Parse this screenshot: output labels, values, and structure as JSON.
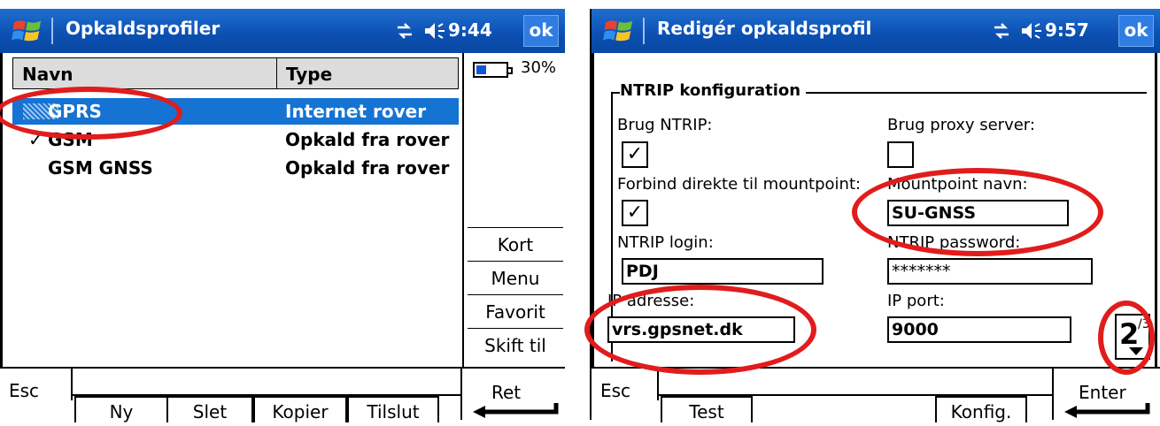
{
  "left": {
    "title": "Opkaldsprofiler",
    "clock": "9:44",
    "ok_label": "ok",
    "battery": {
      "text": "30%",
      "level": 0.3
    },
    "columns": [
      "Navn",
      "Type"
    ],
    "rows": [
      {
        "name": "GPRS",
        "type": "Internet rover",
        "selected": true,
        "checked": false
      },
      {
        "name": "GSM",
        "type": "Opkald fra rover",
        "selected": false,
        "checked": true
      },
      {
        "name": "GSM GNSS",
        "type": "Opkald fra rover",
        "selected": false,
        "checked": false
      }
    ],
    "check_mark": "✓",
    "side_buttons": [
      "Kort",
      "Menu",
      "Favorit",
      "Skift til"
    ],
    "esc_label": "Esc",
    "tabs": [
      "Ny",
      "Slet",
      "Kopier",
      "Tilslut"
    ],
    "enter_label": "Ret"
  },
  "right": {
    "title": "Redigér opkaldsprofil",
    "clock": "9:57",
    "ok_label": "ok",
    "group_title": "NTRIP konfiguration",
    "use_ntrip_label": "Brug NTRIP:",
    "use_ntrip_checked": true,
    "use_proxy_label": "Brug proxy server:",
    "use_proxy_checked": false,
    "direct_label": "Forbind direkte til mountpoint:",
    "direct_checked": true,
    "mountpoint_label": "Mountpoint navn:",
    "mountpoint_value": "SU-GNSS",
    "login_label": "NTRIP login:",
    "login_value": "PDJ",
    "password_label": "NTRIP password:",
    "password_value": "*******",
    "ip_label": "IP adresse:",
    "ip_value": "vrs.gpsnet.dk",
    "port_label": "IP port:",
    "port_value": "9000",
    "page_current": "2",
    "page_total": "/3",
    "esc_label": "Esc",
    "tabs": [
      "Test",
      "Konfig."
    ],
    "enter_label": "Enter",
    "check_mark": "✓"
  },
  "colors": {
    "titlebar": "#0b4fb1",
    "selection": "#1473d3",
    "annotation": "#e11c1c"
  }
}
